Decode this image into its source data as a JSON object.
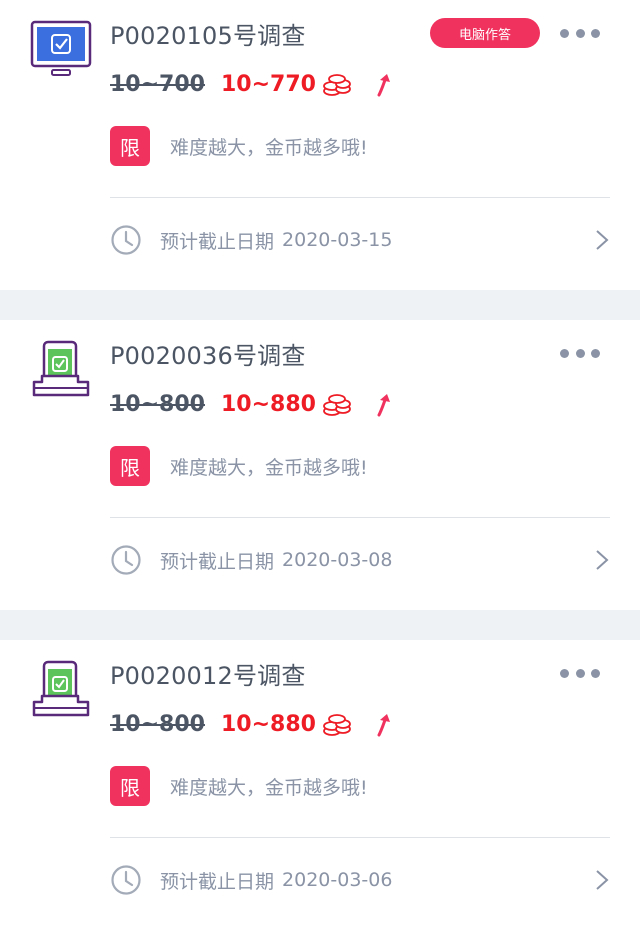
{
  "surveys": [
    {
      "device": "computer",
      "title": "P0020105号调查",
      "badge": "电脑作答",
      "old_price": "10~700",
      "new_price": "10~770",
      "limit_label": "限",
      "limit_text": "难度越大，金币越多哦!",
      "deadline_label": "预计截止日期",
      "deadline_date": "2020-03-15"
    },
    {
      "device": "phone",
      "title": "P0020036号调查",
      "badge": "",
      "old_price": "10~800",
      "new_price": "10~880",
      "limit_label": "限",
      "limit_text": "难度越大，金币越多哦!",
      "deadline_label": "预计截止日期",
      "deadline_date": "2020-03-08"
    },
    {
      "device": "phone",
      "title": "P0020012号调查",
      "badge": "",
      "old_price": "10~800",
      "new_price": "10~880",
      "limit_label": "限",
      "limit_text": "难度越大，金币越多哦!",
      "deadline_label": "预计截止日期",
      "deadline_date": "2020-03-06"
    }
  ],
  "icons": {
    "computer": "monitor-check-icon",
    "phone": "phone-check-icon",
    "coins": "coin-stack-icon",
    "up": "arrow-up-icon",
    "clock": "clock-icon",
    "more": "more-dots-icon",
    "chevron": "chevron-right-icon"
  },
  "colors": {
    "accent": "#f0325f",
    "price_new": "#ee1c25",
    "text_primary": "#4b5563",
    "text_secondary": "#8a94a6",
    "monitor_screen": "#3b6fe0",
    "phone_screen": "#5cc45a",
    "outline": "#5a2a7a"
  }
}
